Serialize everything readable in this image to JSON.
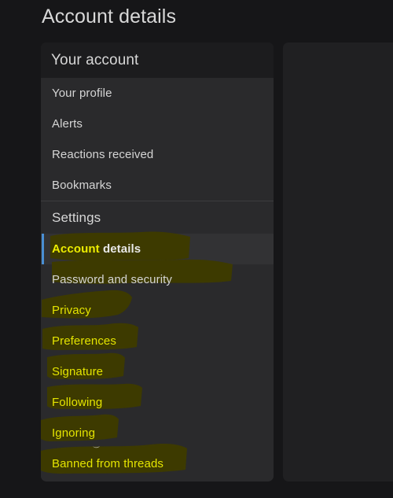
{
  "page": {
    "title": "Account details",
    "background_color": "#161618"
  },
  "nav_card": {
    "header": "Your account",
    "accent_color": "#4a8fd4",
    "highlight_color": "#3d3a00",
    "highlight_text_color": "#e4e400",
    "items": [
      {
        "label": "Your profile",
        "type": "link",
        "active": false,
        "highlighted": false
      },
      {
        "label": "Alerts",
        "type": "link",
        "active": false,
        "highlighted": false
      },
      {
        "label": "Reactions received",
        "type": "link",
        "active": false,
        "highlighted": false
      },
      {
        "label": "Bookmarks",
        "type": "link",
        "active": false,
        "highlighted": false
      },
      {
        "label": "Settings",
        "type": "section",
        "active": false,
        "highlighted": false
      },
      {
        "label": "Account details",
        "type": "link",
        "active": true,
        "highlighted": true
      },
      {
        "label": "Password and security",
        "type": "link",
        "active": false,
        "highlighted": true
      },
      {
        "label": "Privacy",
        "type": "link",
        "active": false,
        "highlighted": true
      },
      {
        "label": "Preferences",
        "type": "link",
        "active": false,
        "highlighted": true
      },
      {
        "label": "Signature",
        "type": "link",
        "active": false,
        "highlighted": true
      },
      {
        "label": "Following",
        "type": "link",
        "active": false,
        "highlighted": true
      },
      {
        "label": "Ignoring",
        "type": "link",
        "active": false,
        "highlighted": true
      },
      {
        "label": "Banned from threads",
        "type": "link",
        "active": false,
        "highlighted": true
      }
    ],
    "active_label_parts": {
      "marked": "Account",
      "unmarked": " details"
    }
  },
  "right_panel": {
    "content": ""
  },
  "cursor": {
    "icon": "mouse-pointer-icon"
  }
}
